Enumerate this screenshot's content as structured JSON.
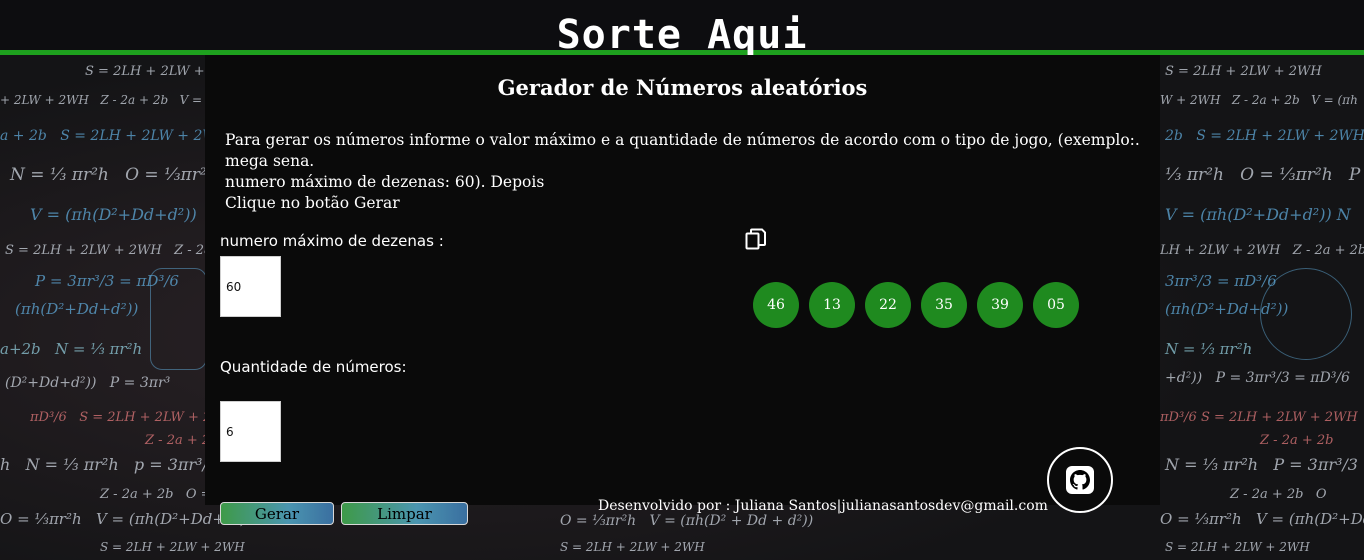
{
  "app": {
    "brand": "Sorte Aqui"
  },
  "main": {
    "title": "Gerador de Números aleatórios",
    "intro_line1": "Para gerar os números informe o valor máximo e a quantidade de números de acordo com o tipo de jogo, (exemplo:. mega sena.",
    "intro_line2": "numero máximo de dezenas: 60). Depois",
    "intro_line3": "Clique no botão Gerar"
  },
  "form": {
    "max_label": "numero máximo de dezenas :",
    "max_value": "60",
    "qty_label": "Quantidade de números:",
    "qty_value": "6"
  },
  "results": {
    "copy_icon": "copy-icon",
    "numbers": [
      "46",
      "13",
      "22",
      "35",
      "39",
      "05"
    ]
  },
  "buttons": {
    "generate": "Gerar",
    "clear": "Limpar"
  },
  "footer": {
    "text": "Desenvolvido por : Juliana Santos|julianasantosdev@gmail.com"
  },
  "github": {
    "icon": "github-icon"
  },
  "colors": {
    "accent_green": "#1ea01e",
    "ball_green": "#1f8a1f",
    "panel": "#0a0a0a"
  }
}
